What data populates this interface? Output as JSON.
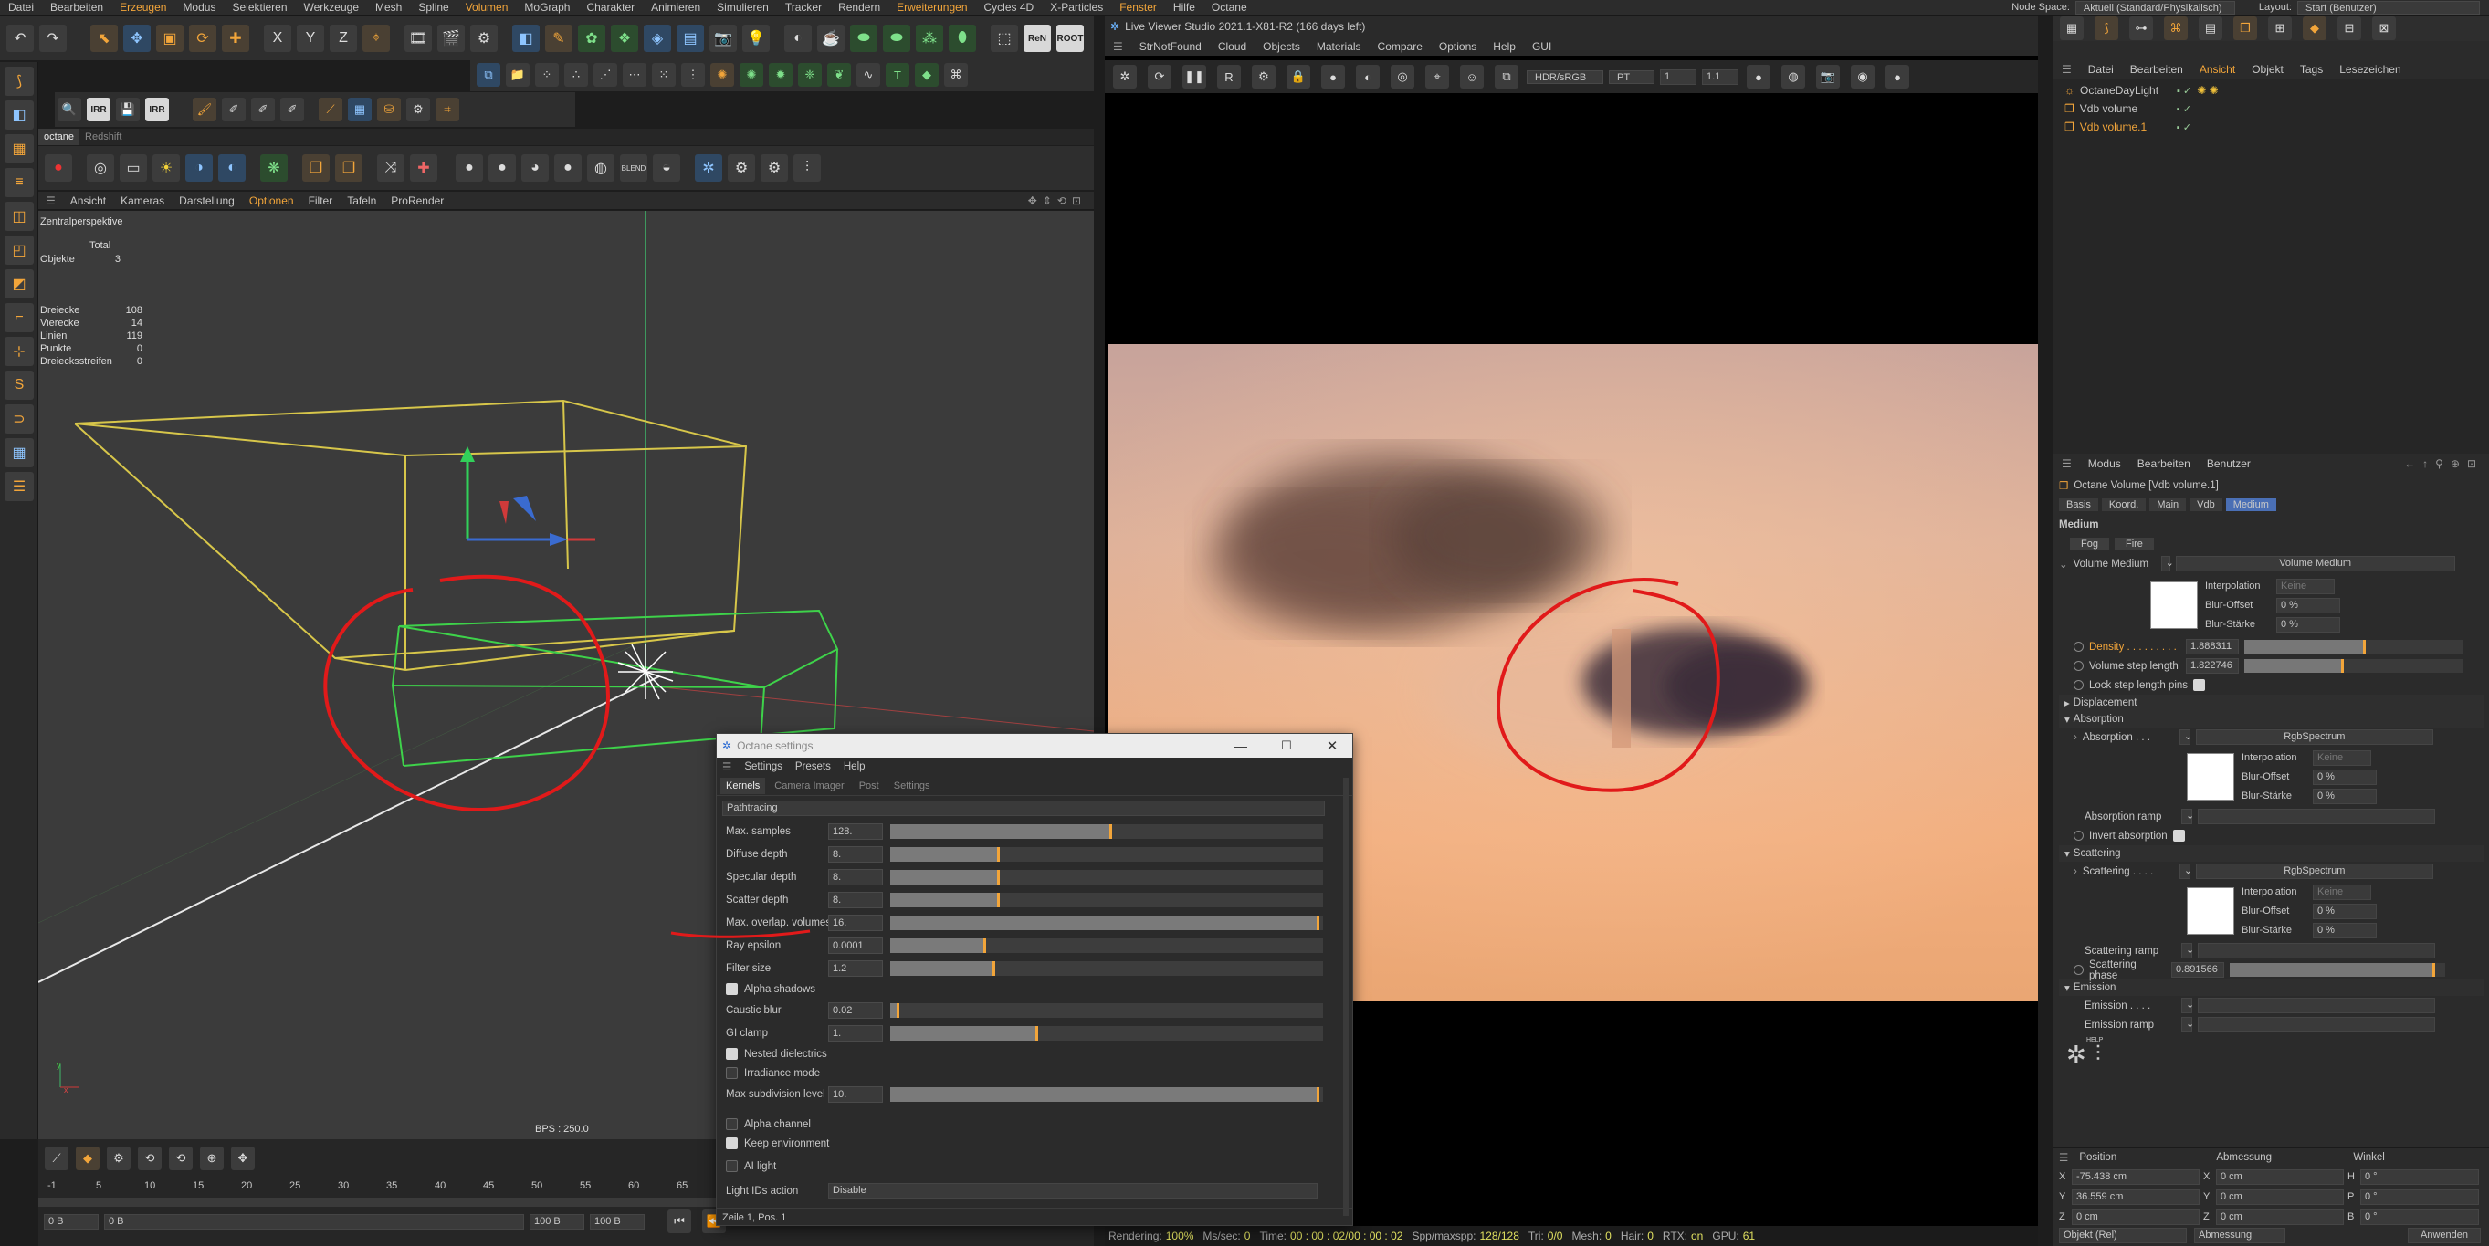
{
  "menubar": {
    "items": [
      "Datei",
      "Bearbeiten",
      "Erzeugen",
      "Modus",
      "Selektieren",
      "Werkzeuge",
      "Mesh",
      "Spline",
      "Volumen",
      "MoGraph",
      "Charakter",
      "Animieren",
      "Simulieren",
      "Tracker",
      "Rendern",
      "Erweiterungen",
      "Cycles 4D",
      "X-Particles",
      "Fenster",
      "Hilfe",
      "Octane"
    ],
    "node_space_label": "Node Space:",
    "node_space_value": "Aktuell (Standard/Physikalisch)",
    "layout_label": "Layout:",
    "layout_value": "Start (Benutzer)"
  },
  "toolbar": {
    "x_label": "X",
    "y_label": "Y",
    "z_label": "Z",
    "irr_label": "IRR",
    "ren_label": "ReN",
    "root_label": "ROOT",
    "blend_label": "BLEND"
  },
  "viewport": {
    "tabs": [
      "octane",
      "Redshift"
    ],
    "menu": [
      "Ansicht",
      "Kameras",
      "Darstellung",
      "Optionen",
      "Filter",
      "Tafeln",
      "ProRender"
    ],
    "title": "Zentralperspektive",
    "stats_header": "Total",
    "stats_top": [
      {
        "label": "Objekte",
        "value": "3"
      }
    ],
    "stats": [
      {
        "label": "Dreiecke",
        "value": "108"
      },
      {
        "label": "Vierecke",
        "value": "14"
      },
      {
        "label": "Linien",
        "value": "119"
      },
      {
        "label": "Punkte",
        "value": "0"
      },
      {
        "label": "Dreiecksstreifen",
        "value": "0"
      }
    ],
    "fps": "BPS : 250.0"
  },
  "timeline": {
    "ticks": [
      "-1",
      "5",
      "10",
      "15",
      "20",
      "25",
      "30",
      "35",
      "40",
      "45",
      "50",
      "55",
      "60",
      "65"
    ],
    "field_start": "0 B",
    "field_current": "0 B",
    "field_end1": "100 B",
    "field_end2": "100 B"
  },
  "live_viewer": {
    "title": "Live Viewer Studio 2021.1-X81-R2 (166 days left)",
    "menu": [
      "StrNotFound",
      "Cloud",
      "Objects",
      "Materials",
      "Compare",
      "Options",
      "Help",
      "GUI"
    ],
    "color_mode": "HDR/sRGB",
    "pt": "PT",
    "val1": "1",
    "val2": "1.1",
    "status": [
      {
        "label": "Rendering:",
        "value": "100%"
      },
      {
        "label": "Ms/sec:",
        "value": "0"
      },
      {
        "label": "Time:",
        "value": "00 : 00 : 02/00 : 00 : 02"
      },
      {
        "label": "Spp/maxspp:",
        "value": "128/128"
      },
      {
        "label": "Tri:",
        "value": "0/0"
      },
      {
        "label": "Mesh:",
        "value": "0"
      },
      {
        "label": "Hair:",
        "value": "0"
      },
      {
        "label": "RTX:",
        "value": "on"
      },
      {
        "label": "GPU:",
        "value": "61"
      }
    ]
  },
  "object_manager": {
    "menu": [
      "Datei",
      "Bearbeiten",
      "Ansicht",
      "Objekt",
      "Tags",
      "Lesezeichen"
    ],
    "objects": [
      "OctaneDayLight",
      "Vdb volume",
      "Vdb volume.1"
    ]
  },
  "attributes": {
    "menu": [
      "Modus",
      "Bearbeiten",
      "Benutzer"
    ],
    "object_title": "Octane Volume [Vdb volume.1]",
    "tabs": [
      "Basis",
      "Koord.",
      "Main",
      "Vdb",
      "Medium"
    ],
    "active_tab": "Medium",
    "section_title": "Medium",
    "subtabs": [
      "Fog",
      "Fire"
    ],
    "volume_medium_label": "Volume Medium",
    "volume_medium_value": "Volume Medium",
    "interpolation_label": "Interpolation",
    "interpolation_value": "Keine",
    "blur_offset_label": "Blur-Offset",
    "blur_offset_value": "0 %",
    "blur_strength_label": "Blur-Stärke",
    "blur_strength_value": "0 %",
    "density_label": "Density . . . . . . . . .",
    "density_value": "1.888311",
    "density_fraction": 0.55,
    "step_length_label": "Volume step length",
    "step_length_value": "1.822746",
    "step_length_fraction": 0.45,
    "lock_step_label": "Lock step length pins",
    "displacement_label": "Displacement",
    "absorption_section": "Absorption",
    "absorption_label": "Absorption . . .",
    "absorption_value": "RgbSpectrum",
    "absorption_ramp_label": "Absorption ramp",
    "invert_absorption_label": "Invert absorption",
    "scattering_section": "Scattering",
    "scattering_label": "Scattering . . . .",
    "scattering_value": "RgbSpectrum",
    "scattering_ramp_label": "Scattering ramp",
    "scattering_phase_label": "Scattering phase",
    "scattering_phase_value": "0.891566",
    "scattering_phase_fraction": 0.95,
    "emission_section": "Emission",
    "emission_label": "Emission . . . .",
    "emission_ramp_label": "Emission ramp",
    "help_label": "HELP"
  },
  "coords": {
    "headers": [
      "Position",
      "Abmessung",
      "Winkel"
    ],
    "rows": [
      {
        "axis": "X",
        "pos": "-75.438 cm",
        "size_axis": "X",
        "size": "0 cm",
        "ang_axis": "H",
        "ang": "0 °"
      },
      {
        "axis": "Y",
        "pos": "36.559 cm",
        "size_axis": "Y",
        "size": "0 cm",
        "ang_axis": "P",
        "ang": "0 °"
      },
      {
        "axis": "Z",
        "pos": "0 cm",
        "size_axis": "Z",
        "size": "0 cm",
        "ang_axis": "B",
        "ang": "0 °"
      }
    ],
    "mode_value": "Objekt (Rel)",
    "size_mode_value": "Abmessung",
    "apply_label": "Anwenden"
  },
  "octane_settings": {
    "title": "Octane settings",
    "menu": [
      "Settings",
      "Presets",
      "Help"
    ],
    "tabs": [
      "Kernels",
      "Camera Imager",
      "Post",
      "Settings"
    ],
    "active_tab": "Kernels",
    "kernel": "Pathtracing",
    "params": [
      {
        "label": "Max. samples",
        "value": "128.",
        "fraction": 0.51
      },
      {
        "label": "Diffuse depth",
        "value": "8.",
        "fraction": 0.25
      },
      {
        "label": "Specular depth",
        "value": "8.",
        "fraction": 0.25
      },
      {
        "label": "Scatter depth",
        "value": "8.",
        "fraction": 0.25
      },
      {
        "label": "Max. overlap. volumes",
        "value": "16.",
        "fraction": 0.99
      },
      {
        "label": "Ray epsilon",
        "value": "0.0001",
        "fraction": 0.22
      },
      {
        "label": "Filter size",
        "value": "1.2",
        "fraction": 0.24
      }
    ],
    "alpha_shadows_label": "Alpha shadows",
    "params2": [
      {
        "label": "Caustic blur",
        "value": "0.02",
        "fraction": 0.02
      },
      {
        "label": "GI clamp",
        "value": "1.",
        "fraction": 0.34
      }
    ],
    "nested_label": "Nested dielectrics",
    "irradiance_label": "Irradiance mode",
    "max_subdiv_label": "Max subdivision level",
    "max_subdiv_value": "10.",
    "max_subdiv_fraction": 0.99,
    "alpha_channel_label": "Alpha channel",
    "keep_env_label": "Keep environment",
    "ai_light_label": "AI light",
    "light_ids_label": "Light IDs action",
    "light_ids_value": "Disable",
    "status": "Zeile 1, Pos. 1"
  },
  "colors": {
    "accent": "#f2a53a",
    "annotation_red": "#e11a1a",
    "active_tab_blue": "#4a6fb5"
  }
}
